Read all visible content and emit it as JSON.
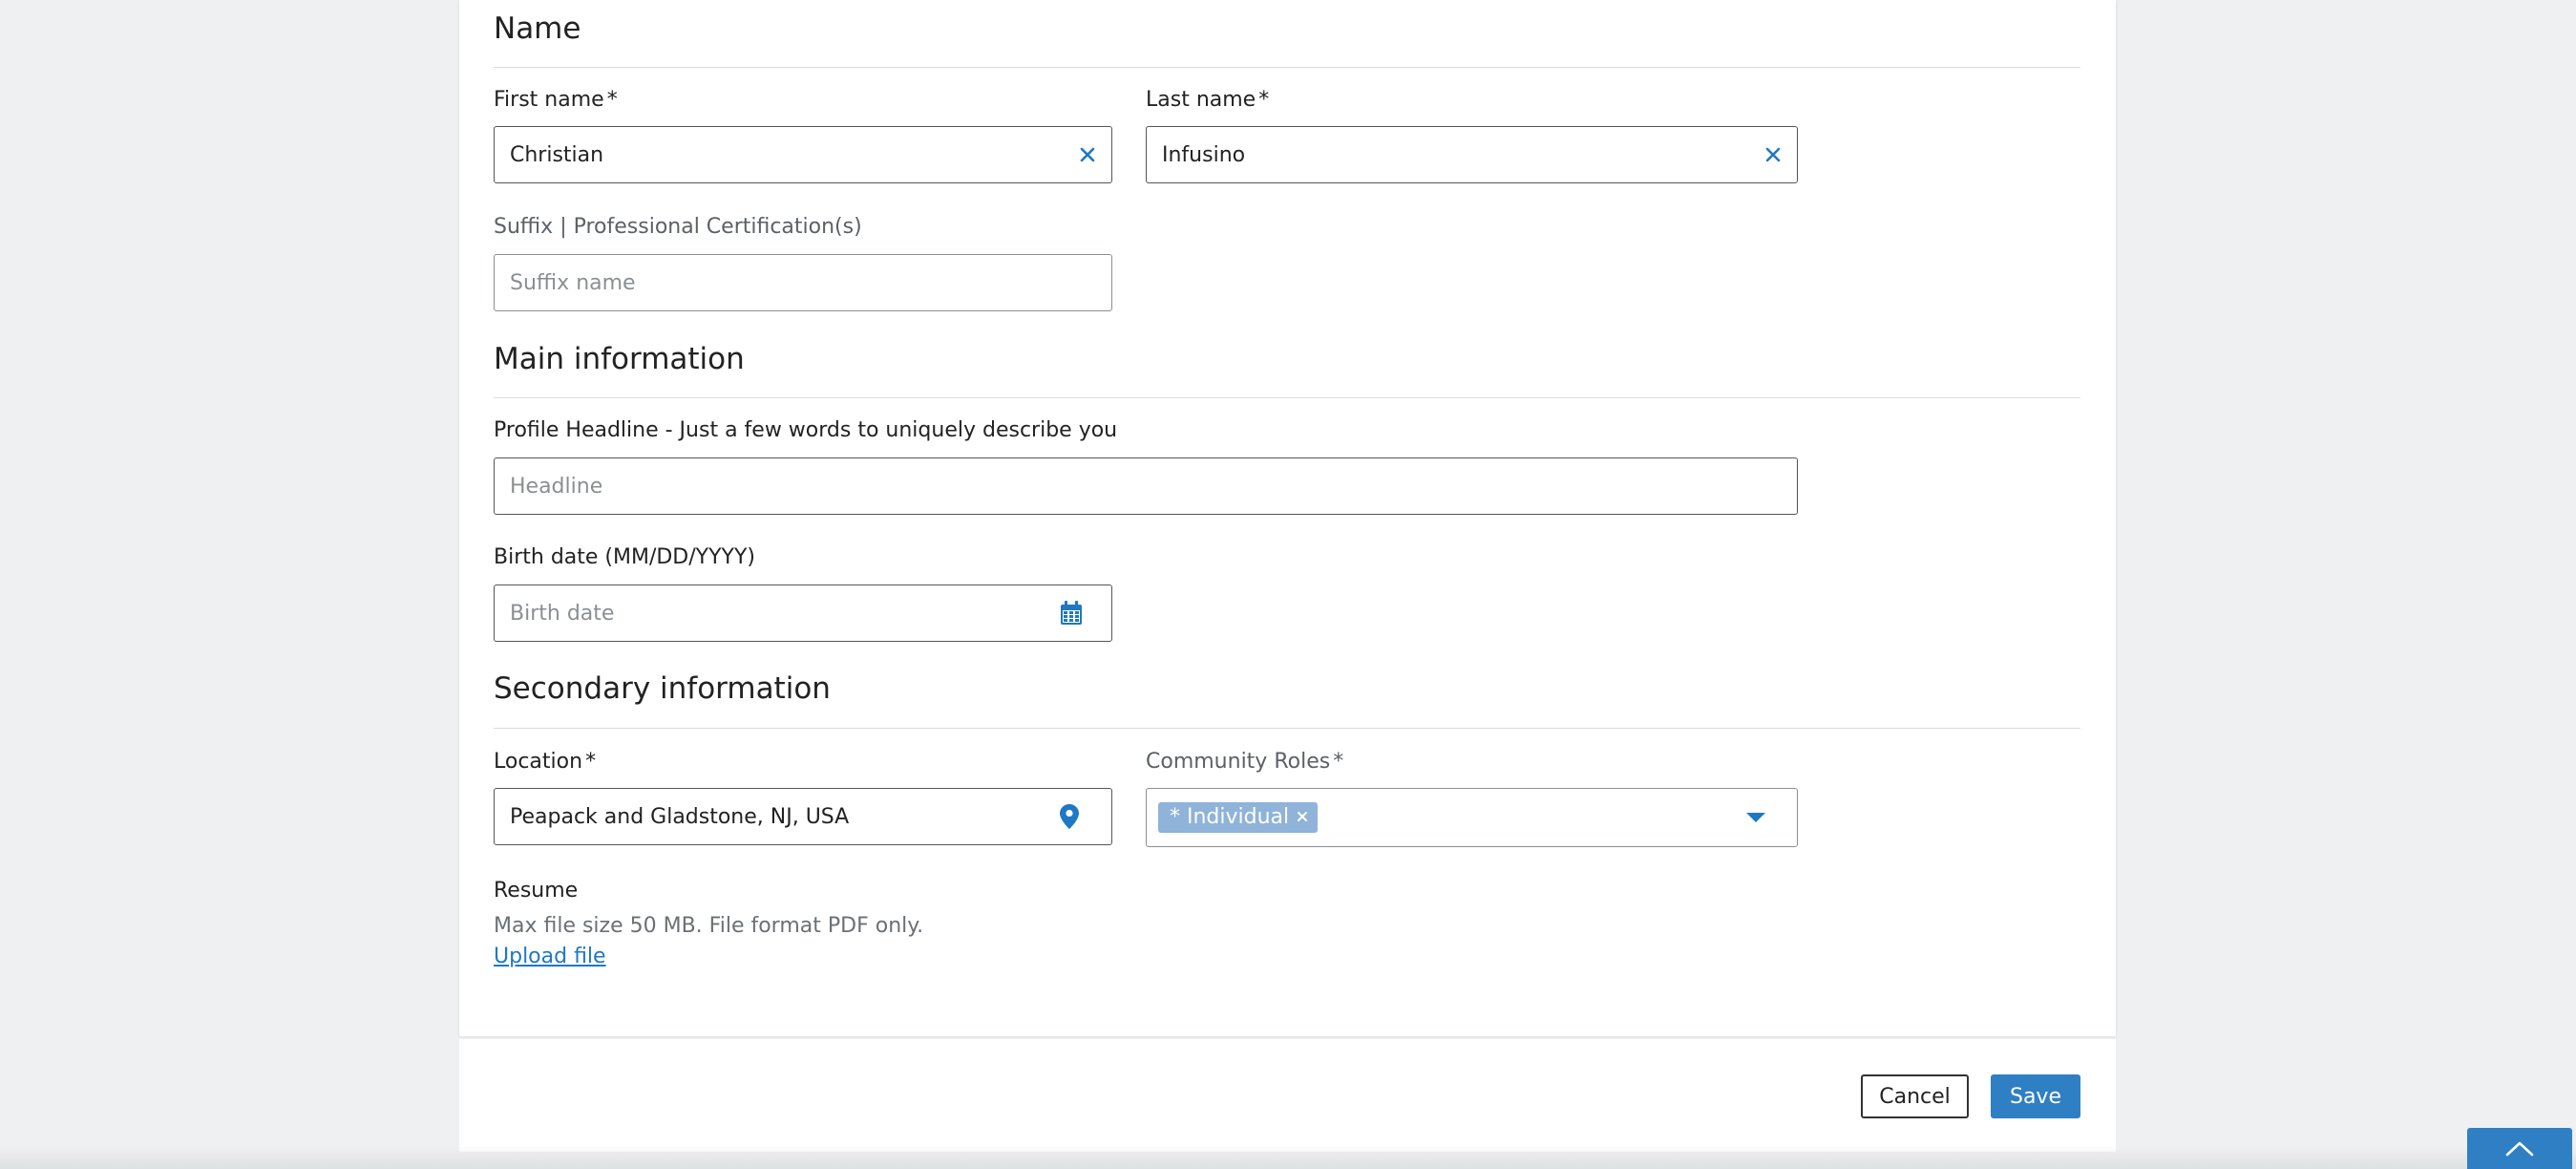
{
  "sections": {
    "name": {
      "title": "Name",
      "first_name": {
        "label": "First name",
        "required": "*",
        "value": "Christian"
      },
      "last_name": {
        "label": "Last name",
        "required": "*",
        "value": "Infusino"
      },
      "suffix": {
        "label": "Suffix | Professional Certification(s)",
        "placeholder": "Suffix name"
      }
    },
    "main": {
      "title": "Main information",
      "headline": {
        "label": "Profile Headline - Just a few words to uniquely describe you",
        "placeholder": "Headline"
      },
      "birth_date": {
        "label": "Birth date (MM/DD/YYYY)",
        "placeholder": "Birth date"
      }
    },
    "secondary": {
      "title": "Secondary information",
      "location": {
        "label": "Location",
        "required": "*",
        "value": "Peapack and Gladstone, NJ, USA"
      },
      "community_roles": {
        "label": "Community Roles",
        "required": "*",
        "chips": [
          "* Individual"
        ]
      },
      "resume": {
        "label": "Resume",
        "help": "Max file size 50 MB. File format PDF only.",
        "upload_link": "Upload file"
      }
    }
  },
  "footer": {
    "cancel_label": "Cancel",
    "save_label": "Save"
  },
  "icons": {
    "clear": "close-icon",
    "calendar": "calendar-icon",
    "location": "map-pin-icon",
    "dropdown": "caret-down-icon",
    "scroll_top": "chevron-up-icon"
  },
  "colors": {
    "accent": "#2f7fc4",
    "chip": "#8fb3d9",
    "link": "#1f78c4",
    "page_bg": "#eef0f1"
  }
}
